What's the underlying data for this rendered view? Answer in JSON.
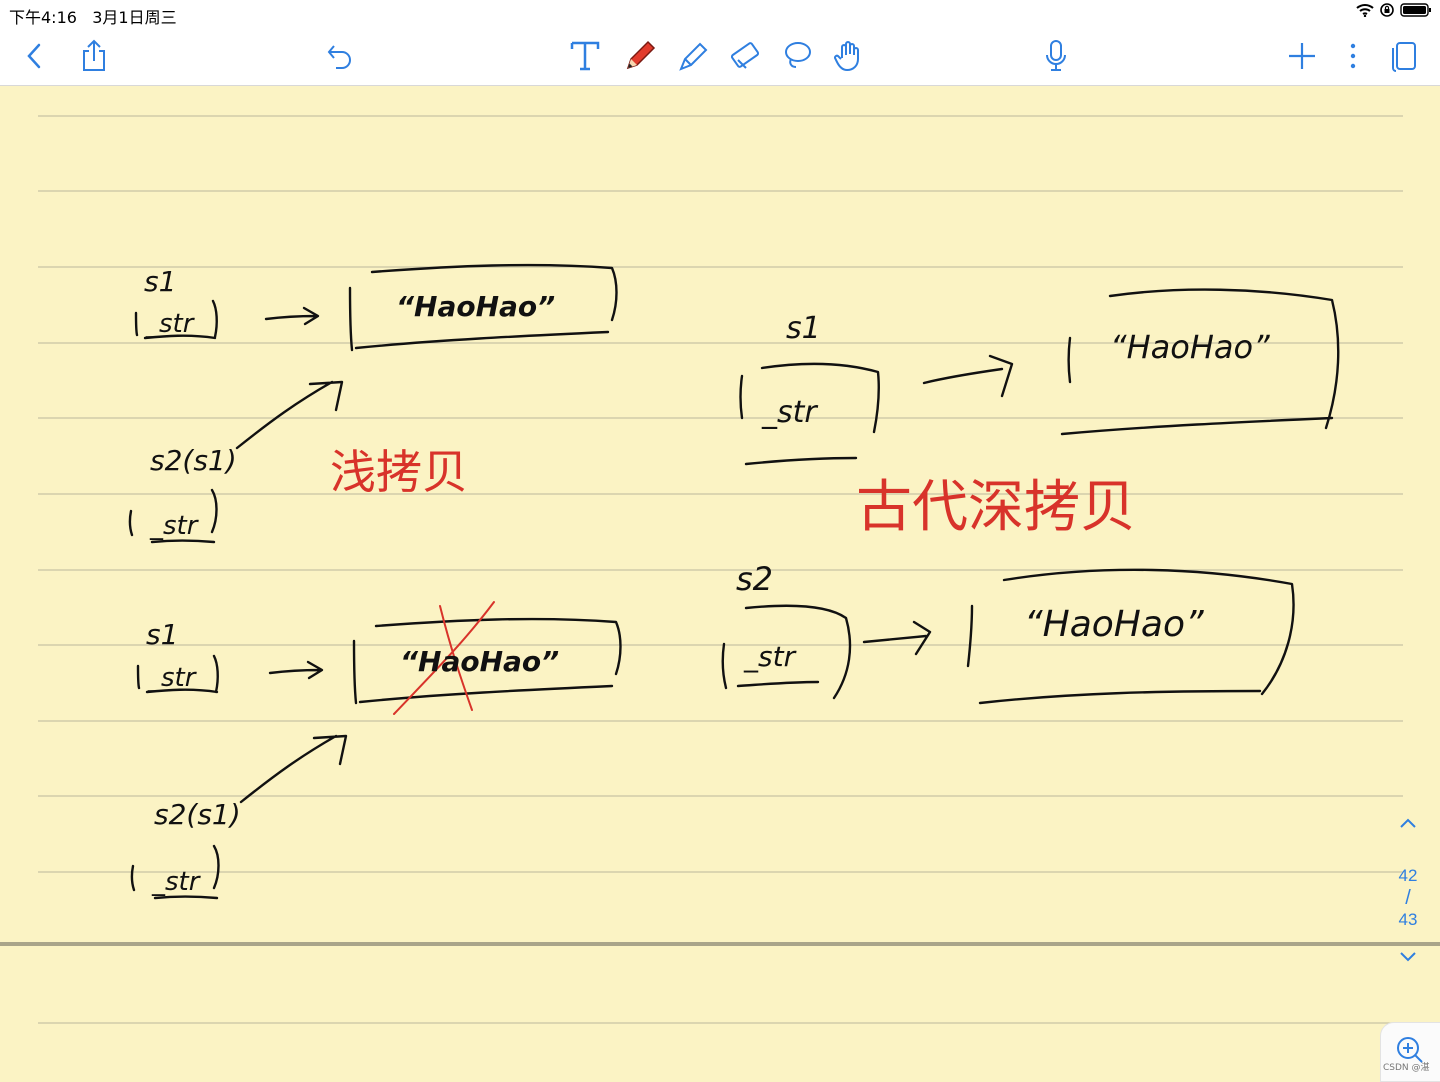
{
  "status": {
    "time": "下午4:16",
    "date": "3月1日周三"
  },
  "toolbar": {
    "back": "chevron-left-icon",
    "share": "share-icon",
    "undo": "undo-icon",
    "tools": [
      "text-tool-icon",
      "pen-icon",
      "highlighter-icon",
      "eraser-icon",
      "lasso-icon",
      "hand-icon"
    ],
    "mic": "microphone-icon",
    "add": "plus-icon",
    "more": "more-icon",
    "pages": "pages-icon"
  },
  "note": {
    "left_top": {
      "s1": "s1",
      "str": "_str",
      "text": "“HaoHao”",
      "s2": "s2(s1)",
      "str2": "_str"
    },
    "shallow_label": "浅拷贝",
    "left_bottom": {
      "s1": "s1",
      "str": "_str",
      "text": "“HaoHao”",
      "s2": "s2(s1)",
      "str2": "_str"
    },
    "right": {
      "s1": "s1",
      "str": "_str",
      "text1": "“HaoHao”",
      "s2": "s2",
      "str2": "_str",
      "text2": "“HaoHao”"
    },
    "deep_label": "古代深拷贝"
  },
  "pager": {
    "current": "42",
    "sep": "/",
    "total": "43"
  },
  "watermark": "CSDN @湛",
  "colors": {
    "paper": "#fbf3c4",
    "rule": "#c8c3a4",
    "ink": "#111111",
    "red": "#d8332a",
    "accent": "#2f7fe0"
  }
}
